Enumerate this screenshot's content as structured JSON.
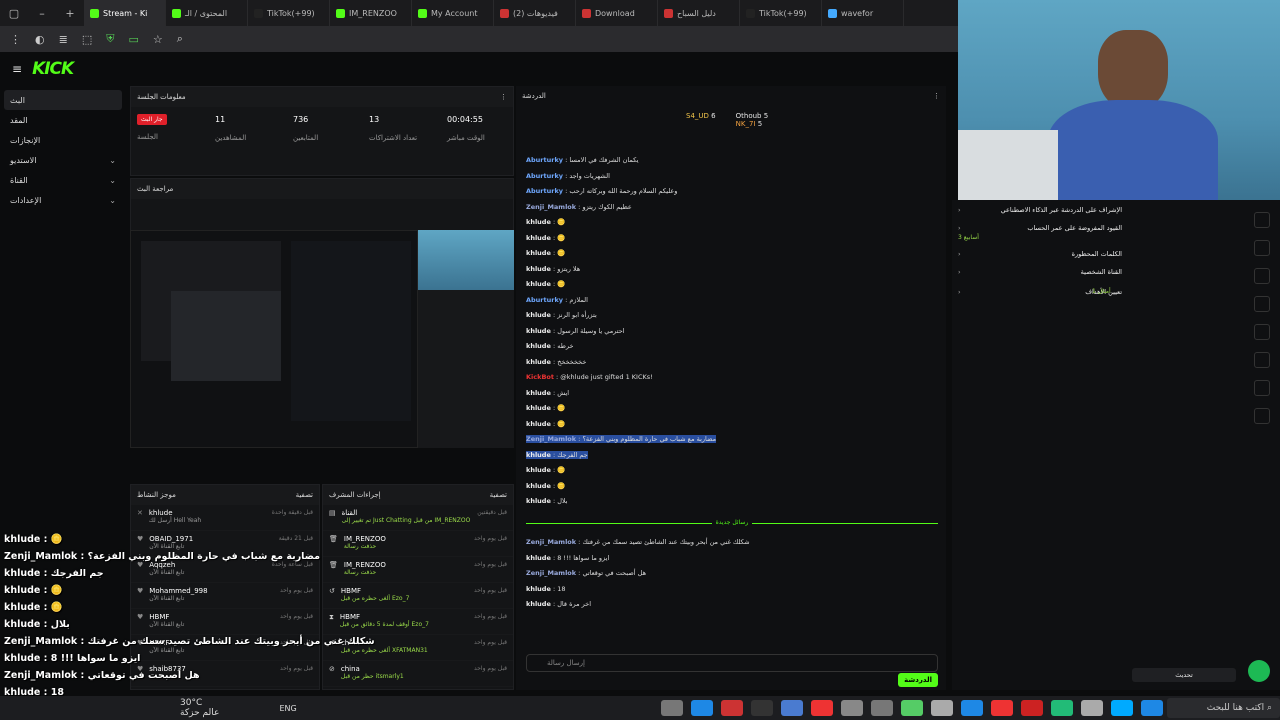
{
  "tabs": [
    "Stream - Ki",
    "المحتوى / الـ",
    "TikTok(+99)",
    "IM_RENZOO",
    "My Account",
    "فيديوهات (2)",
    "Download",
    "دليل السباح",
    "TikTok(+99)",
    "wavefor"
  ],
  "sidebar": {
    "items": [
      "البث",
      "المقد",
      "الإنجازات",
      "الاستديو",
      "القناة",
      "الإعدادات"
    ]
  },
  "session": {
    "title": "معلومات الجلسة",
    "live": "جار البث",
    "live_label": "الجلسة",
    "viewers": "11",
    "viewers_label": "المشاهدين",
    "followers": "736",
    "followers_label": "المتابعين",
    "subs": "13",
    "subs_label": "تعداد الاشتراكات",
    "uptime": "00:04:55",
    "uptime_label": "الوقت مباشر"
  },
  "preview": {
    "title": "مراجعة البث"
  },
  "activity": {
    "title": "موجز النشاط",
    "filter": "تصفية",
    "rows": [
      {
        "name": "khlude",
        "sub": "أرسل لك Hell Yeah",
        "time": "قبل دقيقة واحدة"
      },
      {
        "name": "OBAID_1971",
        "sub": "تابع القناة الآن",
        "time": "قبل 21 دقيقة"
      },
      {
        "name": "Aqqzeh",
        "sub": "تابع القناة الآن",
        "time": "قبل ساعة واحدة"
      },
      {
        "name": "Mohammed_998",
        "sub": "تابع القناة الآن",
        "time": "قبل يوم واحد"
      },
      {
        "name": "HBMF",
        "sub": "تابع القناة الآن",
        "time": "قبل يوم واحد"
      },
      {
        "name": "HBMF",
        "sub": "تابع القناة الآن",
        "time": "قبل يوم واحد"
      },
      {
        "name": "shaib8737",
        "sub": "",
        "time": "قبل يوم واحد"
      }
    ]
  },
  "modactions": {
    "title": "إجراءات المشرف",
    "filter": "تصفية",
    "rows": [
      {
        "name": "القناة",
        "sub": "تم تغيير إلى Just Chatting من قبل IM_RENZOO",
        "time": "قبل دقيقتين"
      },
      {
        "name": "IM_RENZOO",
        "sub": "حذفت رسالة",
        "time": "قبل يوم واحد"
      },
      {
        "name": "IM_RENZOO",
        "sub": "حذفت رسالة",
        "time": "قبل يوم واحد"
      },
      {
        "name": "HBMF",
        "sub": "ألغى حظره من قبل Ezo_7",
        "time": "قبل يوم واحد"
      },
      {
        "name": "HBMF",
        "sub": "أوقف لمدة 5 دقائق من قبل Ezo_7",
        "time": "قبل يوم واحد"
      },
      {
        "name": "china",
        "sub": "ألغى حظره من قبل XFATMAN31",
        "time": "قبل يوم واحد"
      },
      {
        "name": "china",
        "sub": "حظر من قبل itsmarly1",
        "time": "قبل يوم واحد"
      }
    ]
  },
  "chat": {
    "title": "الدردشة",
    "top1": "S4_UD",
    "top1_n": "6",
    "top2": "Othoub",
    "top2_n": "5",
    "top3": "NK_7I",
    "top3_n": "5",
    "messages": [
      {
        "u": "Aburturky",
        "t": "يكمان الشرفك في الامسا"
      },
      {
        "u": "Aburturky",
        "t": "الشهريات واجد"
      },
      {
        "u": "Aburturky",
        "t": "وعليكم السلام ورحمة الله وبركاته ارحب"
      },
      {
        "u": "Zenji_Mamlok",
        "t": "عظيم الكوك ريتزو"
      },
      {
        "u": "khlude",
        "t": "🪙"
      },
      {
        "u": "khlude",
        "t": "🪙"
      },
      {
        "u": "khlude",
        "t": "🪙"
      },
      {
        "u": "khlude",
        "t": "هلا ريتزو"
      },
      {
        "u": "khlude",
        "t": "🪙"
      },
      {
        "u": "Aburturky",
        "t": "الملازم"
      },
      {
        "u": "khlude",
        "t": "بتزرأه ابو الرنز"
      },
      {
        "u": "khlude",
        "t": "احترمي يا وسيلة الرسول"
      },
      {
        "u": "khlude",
        "t": "خرطه"
      },
      {
        "u": "khlude",
        "t": "خخخخخخخ"
      },
      {
        "u": "KickBot",
        "t": "@khlude just gifted 1 KICKs!"
      },
      {
        "u": "khlude",
        "t": "ايش"
      },
      {
        "u": "khlude",
        "t": "🪙"
      },
      {
        "u": "khlude",
        "t": "🪙"
      },
      {
        "u": "Zenji_Mamlok",
        "t": "مضاربة مع شباب في حارة المظلوم وبني الفزعة؟"
      },
      {
        "u": "khlude",
        "t": "جم الفرجك"
      },
      {
        "u": "khlude",
        "t": "🪙"
      },
      {
        "u": "khlude",
        "t": "🪙"
      },
      {
        "u": "khlude",
        "t": "بلال"
      }
    ],
    "new_label": "رسائل جديدة",
    "new_messages": [
      {
        "u": "Zenji_Mamlok",
        "t": "شكلك غني من أبحر وبيتك عند الشاطئ تصيد سمك من غرفتك"
      },
      {
        "u": "khlude",
        "t": "8 !!! ايزو ما سواها"
      },
      {
        "u": "Zenji_Mamlok",
        "t": "هل أصبحت في توقعاتي"
      },
      {
        "u": "khlude",
        "t": "18"
      },
      {
        "u": "khlude",
        "t": "اخر مرة قال"
      }
    ],
    "input_placeholder": "إرسال رسالة",
    "send": "الدردشة"
  },
  "overlay": [
    {
      "u": "khlude",
      "t": "🪙"
    },
    {
      "u": "Zenji_Mamlok",
      "t": "مضاربة مع شباب في حارة المظلوم وبني الفزعة؟"
    },
    {
      "u": "khlude",
      "t": "جم الفرجك"
    },
    {
      "u": "khlude",
      "t": "🪙"
    },
    {
      "u": "khlude",
      "t": "🪙"
    },
    {
      "u": "khlude",
      "t": "بلال"
    },
    {
      "u": "Zenji_Mamlok",
      "t": "شكلك غني من أبحر وبيتك عند الشاطئ تصيد سمك من غرفتك"
    },
    {
      "u": "khlude",
      "t": "8 !!! ايزو ما سواها"
    },
    {
      "u": "Zenji_Mamlok",
      "t": "هل أصبحت في توقعاتي"
    },
    {
      "u": "khlude",
      "t": "18"
    },
    {
      "u": "khlude",
      "t": "اخر مرة قال"
    }
  ],
  "modtools": {
    "items": [
      "الإشراف على الدردشة عبر الذكاء الاصطناعي",
      "القيود المفروضة على عمر الحساب",
      "الكلمات المحظورة",
      "القناة الشخصية",
      "تعيين الأهداف"
    ],
    "sub": "أسابيع 3",
    "goal_count": "1 أمثال",
    "update": "تحديث"
  },
  "taskbar": {
    "weather": "30°C عالم حزكة",
    "lang": "ENG",
    "search": "اكتب هنا للبحث"
  }
}
